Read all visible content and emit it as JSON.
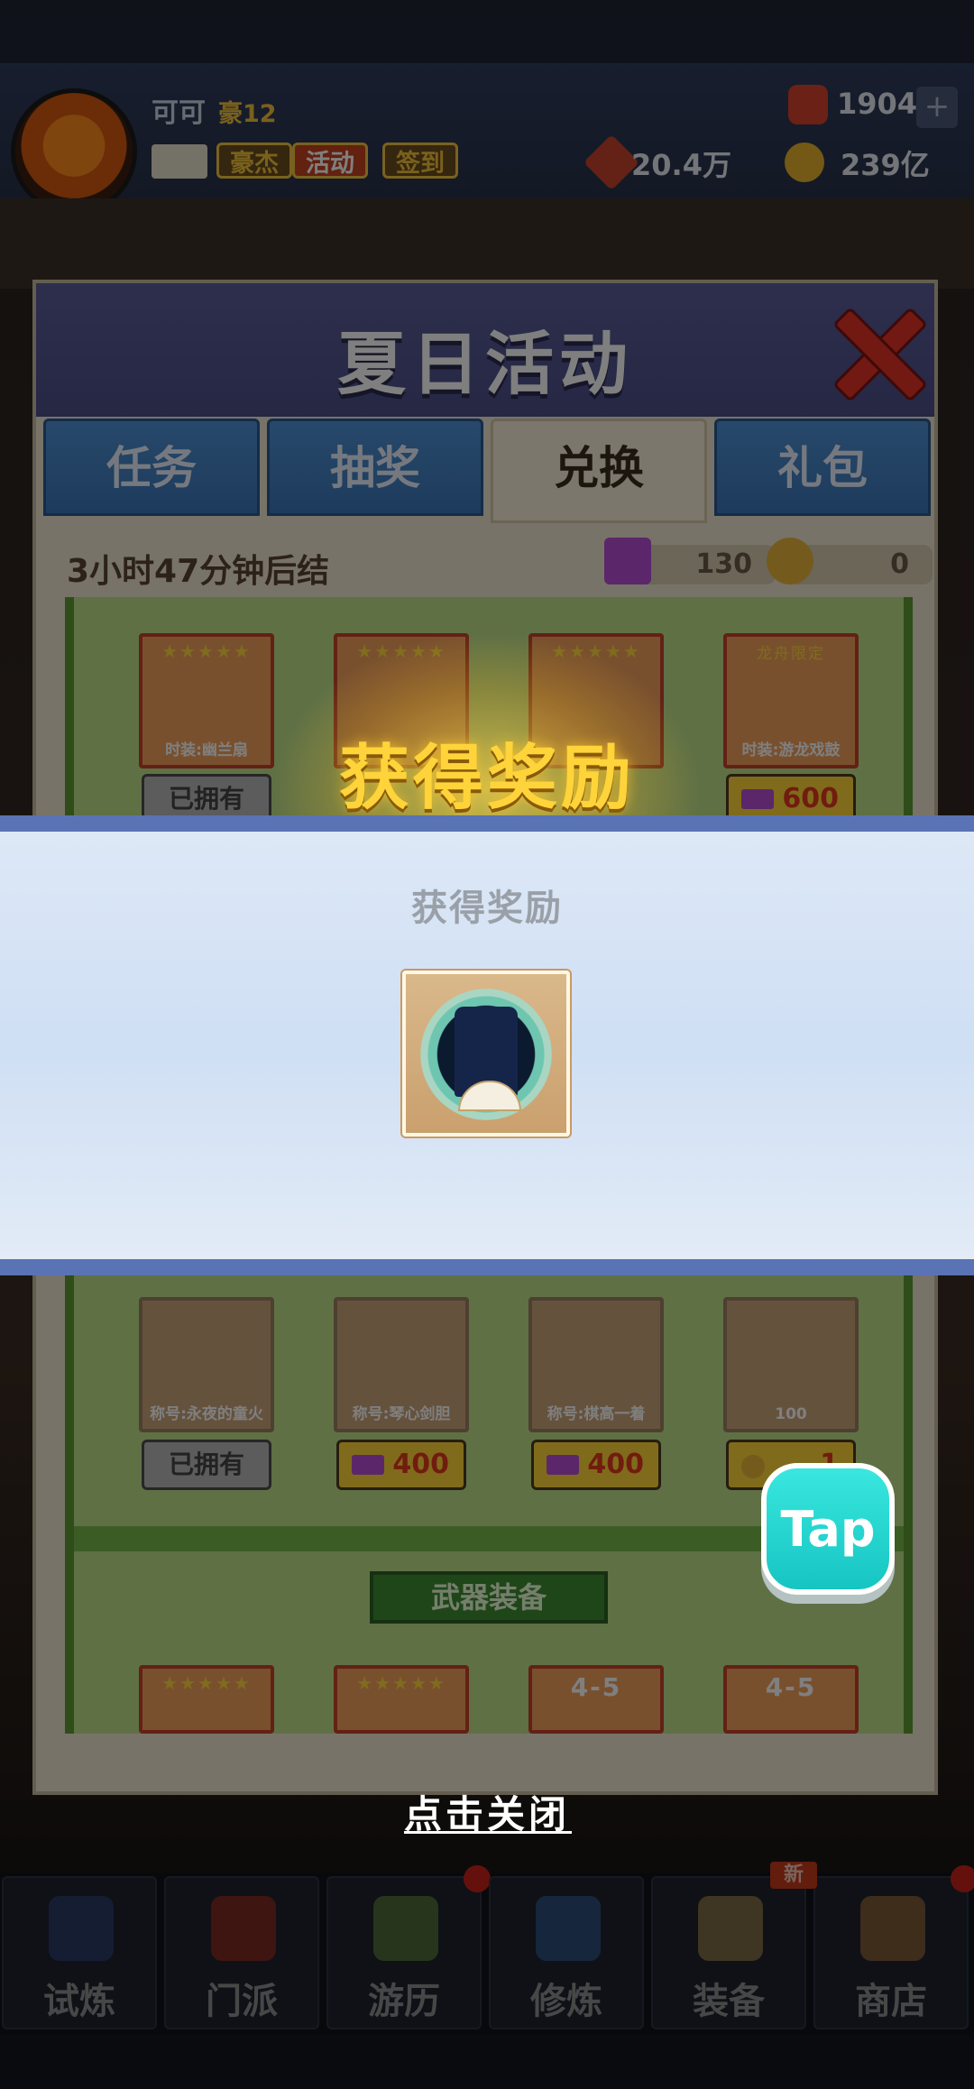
{
  "player": {
    "name": "可可",
    "rank": "豪12"
  },
  "header": {
    "chips": [
      "豪杰",
      "活动",
      "签到"
    ],
    "power": "20.4万",
    "gems": "1904",
    "gold": "239亿",
    "plus": "+"
  },
  "panel": {
    "title": "夏日活动",
    "tabs": [
      "任务",
      "抽奖",
      "兑换",
      "礼包"
    ],
    "active_tab": "兑换",
    "timer": "3小时47分钟后结",
    "tickets": "130",
    "coins": "0",
    "row1": [
      {
        "label": "时装:幽兰扇",
        "button": "已拥有"
      },
      {
        "label": "",
        "button": ""
      },
      {
        "label": "",
        "button": ""
      },
      {
        "label": "时装:游龙戏鼓",
        "button": "600"
      }
    ],
    "row1_tag": "龙舟限定",
    "row2": [
      {
        "label": "称号:永夜的童火",
        "button": "已拥有"
      },
      {
        "label": "称号:琴心剑胆",
        "button": "400"
      },
      {
        "label": "称号:棋高一着",
        "button": "400"
      },
      {
        "label": "100",
        "button": "1"
      }
    ],
    "section_title": "武器装备",
    "row3": [
      "",
      "",
      "4-5",
      "4-5"
    ]
  },
  "reward": {
    "banner": "获得奖励",
    "heading": "获得奖励",
    "close_hint": "点击关闭"
  },
  "tap_badge": "Tap",
  "bottom_nav": [
    "试炼",
    "门派",
    "游历",
    "修炼",
    "装备",
    "商店"
  ],
  "new_tag": "新"
}
